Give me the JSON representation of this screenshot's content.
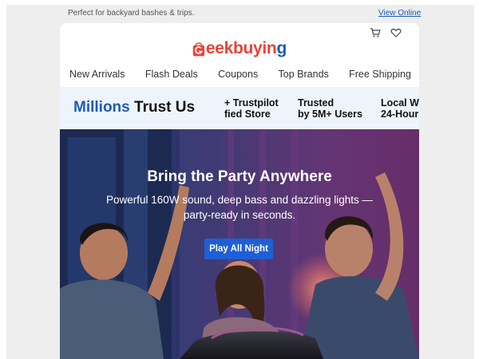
{
  "preheader": {
    "text": "Perfect for backyard bashes & trips.",
    "view_online": "View Online"
  },
  "header": {
    "logo_text_start": "G",
    "logo_text_mid": "eekbuyin",
    "logo_text_end": "g",
    "icons": [
      "cart-icon",
      "heart-icon"
    ]
  },
  "nav": {
    "items": [
      "New Arrivals",
      "Flash Deals",
      "Coupons",
      "Top Brands",
      "Free Shipping"
    ]
  },
  "trust": {
    "title_highlight": "Millions",
    "title_rest": "Trust Us",
    "item1_line1": "+ Trustpilot",
    "item1_line2": "fied Store",
    "item2_line1": "Trusted",
    "item2_line2": "by 5M+ Users",
    "item3_line1": "Local W",
    "item3_line2": "24-Hour"
  },
  "hero": {
    "title": "Bring the Party Anywhere",
    "subtitle_line1": "Powerful 160W sound, deep bass and dazzling lights —",
    "subtitle_line2": "party-ready in seconds.",
    "cta": "Play All Night"
  },
  "colors": {
    "brand_red": "#e8443a",
    "brand_blue": "#1f5bb5",
    "cta_blue": "#1e5fd6",
    "trust_bg": "#eef4fc"
  }
}
